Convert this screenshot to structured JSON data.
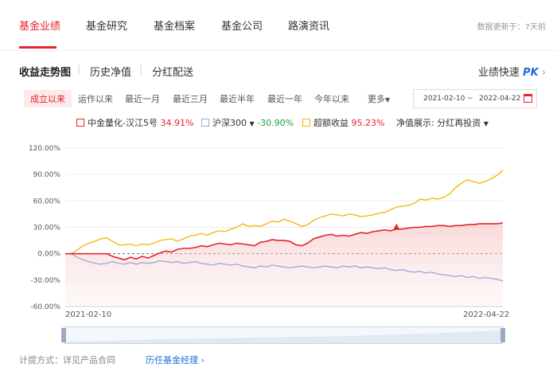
{
  "topnav": {
    "tabs": [
      "基金业绩",
      "基金研究",
      "基金档案",
      "基金公司",
      "路演资讯"
    ],
    "active": 0,
    "updated_text": "数据更新于：7天前"
  },
  "subnav": {
    "tabs": [
      "收益走势图",
      "历史净值",
      "分红配送"
    ],
    "active": 0,
    "pk_prefix": "业绩快速",
    "pk_bold": "PK",
    "pk_chev": "›"
  },
  "ranges": {
    "items": [
      "成立以来",
      "运作以来",
      "最近一月",
      "最近三月",
      "最近半年",
      "最近一年",
      "今年以来"
    ],
    "active": 0,
    "more": "更多",
    "more_caret": "▼",
    "start_date": "2021-02-10",
    "date_sep": "~",
    "end_date": "2022-04-22"
  },
  "legend": {
    "fund_name": "中金量化-汉江5号",
    "fund_return": "34.91%",
    "index_name": "沪深300",
    "index_caret": "▼",
    "index_return": "-30.90%",
    "excess_name": "超额收益",
    "excess_return": "95.23%",
    "display_label": "净值展示:",
    "display_value": "分红再投资",
    "display_caret": "▼"
  },
  "colors": {
    "fund": "#e5242b",
    "index": "#9aa8dc",
    "excess": "#f5b400",
    "accent": "#e5242b",
    "link": "#1a6fd8"
  },
  "chart_data": {
    "type": "line",
    "ylim": [
      -60,
      120
    ],
    "yticks": [
      "120.00%",
      "90.00%",
      "60.00%",
      "30.00%",
      "0.00%",
      "-30.00%",
      "-60.00%"
    ],
    "ytick_values": [
      120,
      90,
      60,
      30,
      0,
      -30,
      -60
    ],
    "x_start": "2021-02-10",
    "x_end": "2022-04-22",
    "grid": true,
    "series": [
      {
        "name": "中金量化-汉江5号",
        "values": [
          0,
          0,
          0,
          0,
          0,
          0,
          0,
          0,
          -3,
          -5,
          -7,
          -4,
          -6,
          -3,
          -5,
          -2,
          1,
          3,
          2,
          5,
          6,
          6,
          7,
          9,
          8,
          10,
          12,
          11,
          10,
          12,
          11,
          10,
          9,
          13,
          14,
          16,
          15,
          15,
          14,
          10,
          9,
          12,
          17,
          19,
          21,
          22,
          20,
          21,
          20,
          22,
          24,
          23,
          25,
          26,
          27,
          26,
          28,
          28,
          29,
          30,
          30,
          31,
          31,
          32,
          32,
          31,
          32,
          32,
          33,
          33,
          34,
          34,
          34,
          34,
          35
        ]
      },
      {
        "name": "沪深300",
        "values": [
          0,
          0,
          -4,
          -7,
          -9,
          -11,
          -12,
          -11,
          -9,
          -11,
          -12,
          -10,
          -12,
          -10,
          -11,
          -10,
          -8,
          -9,
          -10,
          -9,
          -11,
          -10,
          -9,
          -11,
          -12,
          -13,
          -11,
          -12,
          -13,
          -12,
          -14,
          -15,
          -16,
          -14,
          -15,
          -13,
          -14,
          -15,
          -16,
          -15,
          -14,
          -15,
          -16,
          -15,
          -14,
          -15,
          -16,
          -14,
          -15,
          -14,
          -16,
          -15,
          -16,
          -17,
          -16,
          -18,
          -19,
          -18,
          -20,
          -21,
          -20,
          -22,
          -21,
          -23,
          -24,
          -25,
          -26,
          -25,
          -27,
          -26,
          -28,
          -27,
          -28,
          -29,
          -31
        ]
      },
      {
        "name": "超额收益",
        "values": [
          0,
          0,
          4,
          9,
          12,
          14,
          17,
          18,
          14,
          10,
          10,
          11,
          9,
          11,
          10,
          12,
          15,
          16,
          17,
          14,
          17,
          20,
          21,
          23,
          21,
          24,
          26,
          25,
          28,
          30,
          34,
          31,
          32,
          31,
          34,
          37,
          36,
          39,
          37,
          34,
          31,
          33,
          38,
          41,
          43,
          45,
          44,
          43,
          45,
          44,
          42,
          43,
          44,
          46,
          47,
          50,
          53,
          54,
          55,
          57,
          62,
          61,
          63,
          62,
          64,
          68,
          75,
          80,
          84,
          82,
          80,
          82,
          85,
          89,
          95
        ]
      }
    ]
  },
  "xaxis": {
    "start_label": "2021-02-10",
    "end_label": "2022-04-22"
  },
  "footer": {
    "method": "计提方式：详见产品合同",
    "manager_link": "历任基金经理",
    "manager_chev": "›"
  }
}
